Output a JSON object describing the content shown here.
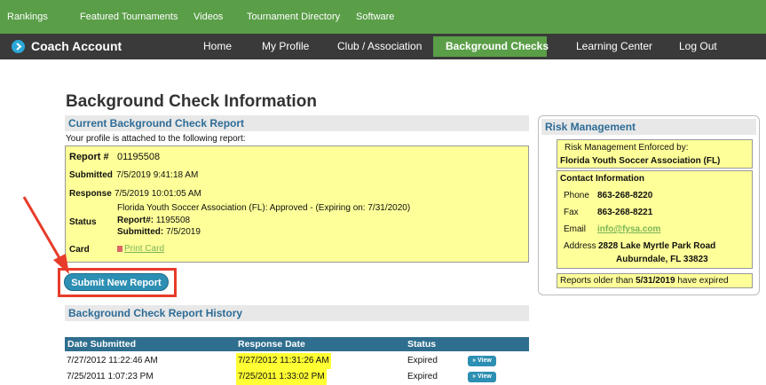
{
  "top_nav": [
    "Rankings",
    "Featured Tournaments",
    "Videos",
    "Tournament Directory",
    "Software"
  ],
  "coach_bar": {
    "title": "Coach Account",
    "items": [
      "Home",
      "My Profile",
      "Club / Association",
      "Background Checks",
      "Learning Center",
      "Log Out"
    ],
    "active": "Background Checks"
  },
  "page": {
    "title": "Background Check Information",
    "current_header": "Current Background Check Report",
    "intro": "Your profile is attached to the following report:"
  },
  "report": {
    "report_label": "Report #",
    "report_value": "01195508",
    "submitted_label": "Submitted",
    "submitted_value": "7/5/2019 9:41:18 AM",
    "response_label": "Response",
    "response_value": "7/5/2019 10:01:05 AM",
    "status_label": "Status",
    "status_line1": "Florida Youth Soccer Association (FL): Approved - (Expiring on: 7/31/2020)",
    "status_report_label": "Report#:",
    "status_report_value": "1195508",
    "status_submitted_label": "Submitted:",
    "status_submitted_value": "7/5/2019",
    "card_label": "Card",
    "card_link": "Print Card"
  },
  "submit_button": "Submit New Report",
  "history": {
    "header": "Background Check Report History",
    "columns": [
      "Date Submitted",
      "Response Date",
      "Status"
    ],
    "rows": [
      {
        "submitted": "7/27/2012 11:22:46 AM",
        "response": "7/27/2012 11:31:26 AM",
        "status": "Expired",
        "action": "» View"
      },
      {
        "submitted": "7/25/2011 1:07:23 PM",
        "response": "7/25/2011 1:33:02 PM",
        "status": "Expired",
        "action": "» View"
      }
    ]
  },
  "risk": {
    "title": "Risk Management",
    "enforced_label": "Risk Management Enforced by:",
    "enforced_org": "Florida Youth Soccer Association (FL)",
    "contact_title": "Contact Information",
    "phone_label": "Phone",
    "phone": "863-268-8220",
    "fax_label": "Fax",
    "fax": "863-268-8221",
    "email_label": "Email",
    "email": "info@fysa.com",
    "address_label": "Address",
    "address_line1": "2828 Lake Myrtle Park Road",
    "address_line2": "Auburndale, FL 33823",
    "expire_prefix": "Reports older than",
    "expire_date": "5/31/2019",
    "expire_suffix": "have expired"
  },
  "colors": {
    "nav_green": "#5a9e48",
    "coach_bar": "#3a3a3a",
    "highlight_yellow": "#ffff99",
    "button_blue": "#2d8fb3",
    "annotation_red": "#e83b2a"
  }
}
